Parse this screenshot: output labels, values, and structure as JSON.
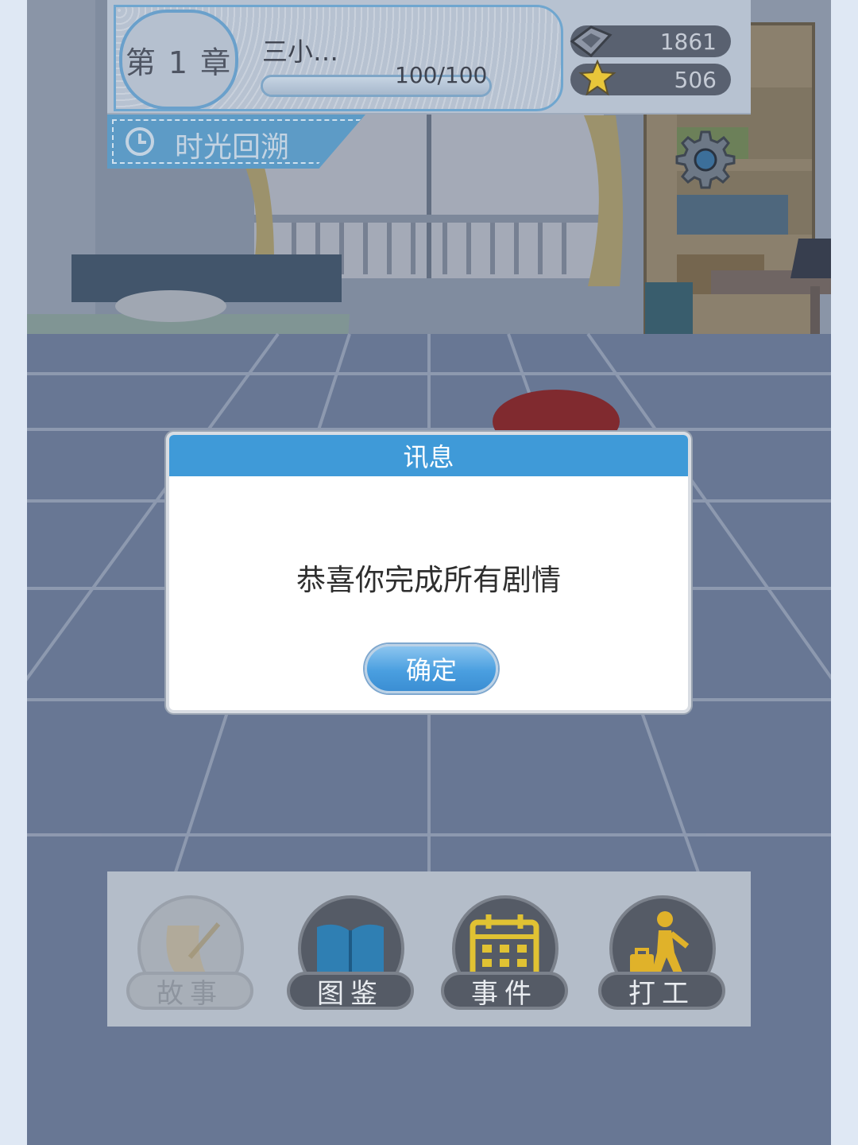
{
  "hud": {
    "chapter_label": "第 1 章",
    "character_name": "三小…",
    "hp_text": "100/100",
    "hp_fraction": 1.0,
    "gems": "1861",
    "stars": "506"
  },
  "rewind": {
    "label": "时光回溯"
  },
  "dialog": {
    "title": "讯息",
    "message": "恭喜你完成所有剧情",
    "confirm_label": "确定"
  },
  "nav": {
    "story_label": "故事",
    "gallery_label": "图鉴",
    "events_label": "事件",
    "work_label": "打工"
  },
  "icons": {
    "gem": "gem-icon",
    "star": "star-icon",
    "clock": "clock-icon",
    "settings": "gear-icon",
    "story": "scroll-quill-icon",
    "gallery": "open-book-icon",
    "events": "calendar-icon",
    "work": "walking-worker-icon"
  },
  "colors": {
    "dialog_header": "#3f9ad8",
    "confirm_button": "#4a9fe0",
    "accent_blue": "#5d9bc6",
    "star_yellow": "#e8c63a",
    "book_blue": "#2f7fb3"
  }
}
